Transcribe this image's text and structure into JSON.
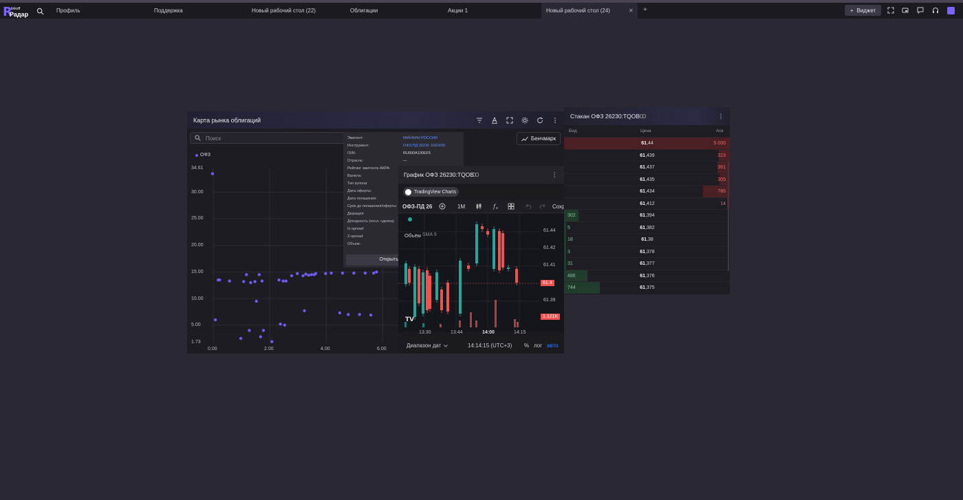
{
  "app": {
    "logo_top": "tinkoff",
    "logo_main": "Радар",
    "logo_letter": "R"
  },
  "tabs": [
    {
      "label": "Профиль"
    },
    {
      "label": "Поддержка"
    },
    {
      "label": "Новый рабочий стол (22)"
    },
    {
      "label": "Облигации"
    },
    {
      "label": "Акции 1"
    },
    {
      "label": "Новый рабочий стол (24)",
      "active": true
    }
  ],
  "topbar": {
    "close_glyph": "✕",
    "plus_glyph": "+",
    "widget_label": "Виджет",
    "widget_plus": "+"
  },
  "bondmap": {
    "title": "Карта рынка облигаций",
    "search_placeholder": "Поиск",
    "benchmark_label": "Бенчмарк",
    "legend_label": "ОФЗ"
  },
  "tooltip": {
    "rows": [
      {
        "label": "Эмитент:",
        "value": "МИНФИН РОССИИ",
        "link": true
      },
      {
        "label": "Инструмент:",
        "value": "ОФЗ-ПД 26230 16/03/39",
        "link": true
      },
      {
        "label": "ISIN:",
        "value": "RU000A100EF5",
        "link": false
      },
      {
        "label": "Отрасль:",
        "value": "—",
        "link": false
      },
      {
        "label": "Рейтинг эмитента АКРА:",
        "value": "",
        "link": false
      },
      {
        "label": "Валюта:",
        "value": "",
        "link": false
      },
      {
        "label": "Тип купона:",
        "value": "",
        "link": false
      },
      {
        "label": "Дата оферты:",
        "value": "",
        "link": false
      },
      {
        "label": "Дата погашения:",
        "value": "",
        "link": false
      },
      {
        "label": "Срок до погашения/оферты",
        "value": "",
        "link": false
      },
      {
        "label": "Дюрация:",
        "value": "",
        "link": false
      },
      {
        "label": "Доходность (посл. сделка)",
        "value": "",
        "link": false
      },
      {
        "label": "G-spread:",
        "value": "",
        "link": false
      },
      {
        "label": "Z-spread:",
        "value": "",
        "link": false
      },
      {
        "label": "Объем:",
        "value": "",
        "link": false
      }
    ],
    "open_label": "Открыть"
  },
  "chart_panel": {
    "title": "График ОФЗ 26230:TQOB",
    "tv_label": "TradingView Charts",
    "symbol": "ОФЗ-ПД 26",
    "interval": "1M",
    "save_label": "Сохр",
    "volume_label": "Объём",
    "sma_label": "SMA 9",
    "date_range_label": "Диапазон дат",
    "clock": "14:14:15 (UTC+3)",
    "percent_label": "%",
    "log_label": "лог",
    "auto_label": "авто",
    "price_badge": "61.4",
    "volume_badge": "1.121K",
    "price_ticks": [
      "61.44",
      "61.42",
      "61.41",
      "61.40",
      "61.39"
    ],
    "time_ticks": [
      "13:30",
      "13:44",
      "14:00",
      "14:15"
    ],
    "accent": "#2f7bff",
    "up_color": "#26a69a",
    "down_color": "#ef5350"
  },
  "orderbook": {
    "title": "Стакан ОФЗ 26230:TQOB",
    "col_bid": "Бид",
    "col_price": "Цена",
    "col_ask": "Аск",
    "asks": [
      {
        "price_int": "61",
        "price_frac": ",44",
        "qty": "5 000"
      },
      {
        "price_int": "61",
        "price_frac": ",439",
        "qty": "323"
      },
      {
        "price_int": "61",
        "price_frac": ",437",
        "qty": "361"
      },
      {
        "price_int": "61",
        "price_frac": ",435",
        "qty": "305"
      },
      {
        "price_int": "61",
        "price_frac": ",434",
        "qty": "786"
      },
      {
        "price_int": "61",
        "price_frac": ",412",
        "qty": "14"
      }
    ],
    "bids": [
      {
        "price_int": "61",
        "price_frac": ",394",
        "qty": "302"
      },
      {
        "price_int": "61",
        "price_frac": ",382",
        "qty": "5"
      },
      {
        "price_int": "61",
        "price_frac": ",38",
        "qty": "18"
      },
      {
        "price_int": "61",
        "price_frac": ",378",
        "qty": "3"
      },
      {
        "price_int": "61",
        "price_frac": ",377",
        "qty": "31"
      },
      {
        "price_int": "61",
        "price_frac": ",376",
        "qty": "486"
      },
      {
        "price_int": "61",
        "price_frac": ",375",
        "qty": "744"
      }
    ]
  },
  "chart_data": {
    "type": "scatter",
    "series": [
      {
        "name": "ОФЗ",
        "color": "#6c5bf0",
        "points": [
          [
            0.0,
            33.5
          ],
          [
            0.1,
            6.0
          ],
          [
            0.2,
            13.5
          ],
          [
            0.25,
            13.5
          ],
          [
            0.6,
            13.3
          ],
          [
            1.0,
            2.5
          ],
          [
            1.1,
            13.2
          ],
          [
            1.2,
            14.5
          ],
          [
            1.3,
            4.0
          ],
          [
            1.35,
            13.0
          ],
          [
            1.5,
            13.2
          ],
          [
            1.55,
            9.5
          ],
          [
            1.65,
            14.5
          ],
          [
            1.7,
            2.8
          ],
          [
            1.75,
            13.3
          ],
          [
            1.8,
            4.0
          ],
          [
            2.1,
            1.9
          ],
          [
            2.35,
            13.5
          ],
          [
            2.4,
            5.2
          ],
          [
            2.5,
            13.3
          ],
          [
            2.55,
            5.0
          ],
          [
            2.6,
            13.3
          ],
          [
            2.8,
            14.3
          ],
          [
            3.0,
            14.7
          ],
          [
            3.2,
            14.3
          ],
          [
            3.25,
            7.7
          ],
          [
            3.3,
            14.6
          ],
          [
            3.4,
            14.4
          ],
          [
            3.5,
            14.5
          ],
          [
            3.6,
            14.5
          ],
          [
            3.65,
            14.7
          ],
          [
            4.0,
            14.7
          ],
          [
            4.2,
            14.8
          ],
          [
            4.5,
            7.3
          ],
          [
            4.6,
            14.8
          ],
          [
            4.8,
            7.0
          ],
          [
            5.0,
            14.8
          ],
          [
            5.2,
            7.0
          ],
          [
            5.4,
            14.8
          ],
          [
            5.6,
            6.9
          ],
          [
            5.7,
            14.8
          ],
          [
            5.8,
            15.0
          ]
        ]
      }
    ],
    "yticks": [
      "34.61",
      "30.00",
      "25.00",
      "20.00",
      "15.00",
      "10.00",
      "5.00",
      "1.73"
    ],
    "xticks": [
      "0.00",
      "2.00",
      "4.00",
      "6.00"
    ],
    "ylim": [
      1.73,
      34.61
    ],
    "xlim": [
      0,
      6.4
    ],
    "grid": true,
    "legend": "top-left"
  }
}
